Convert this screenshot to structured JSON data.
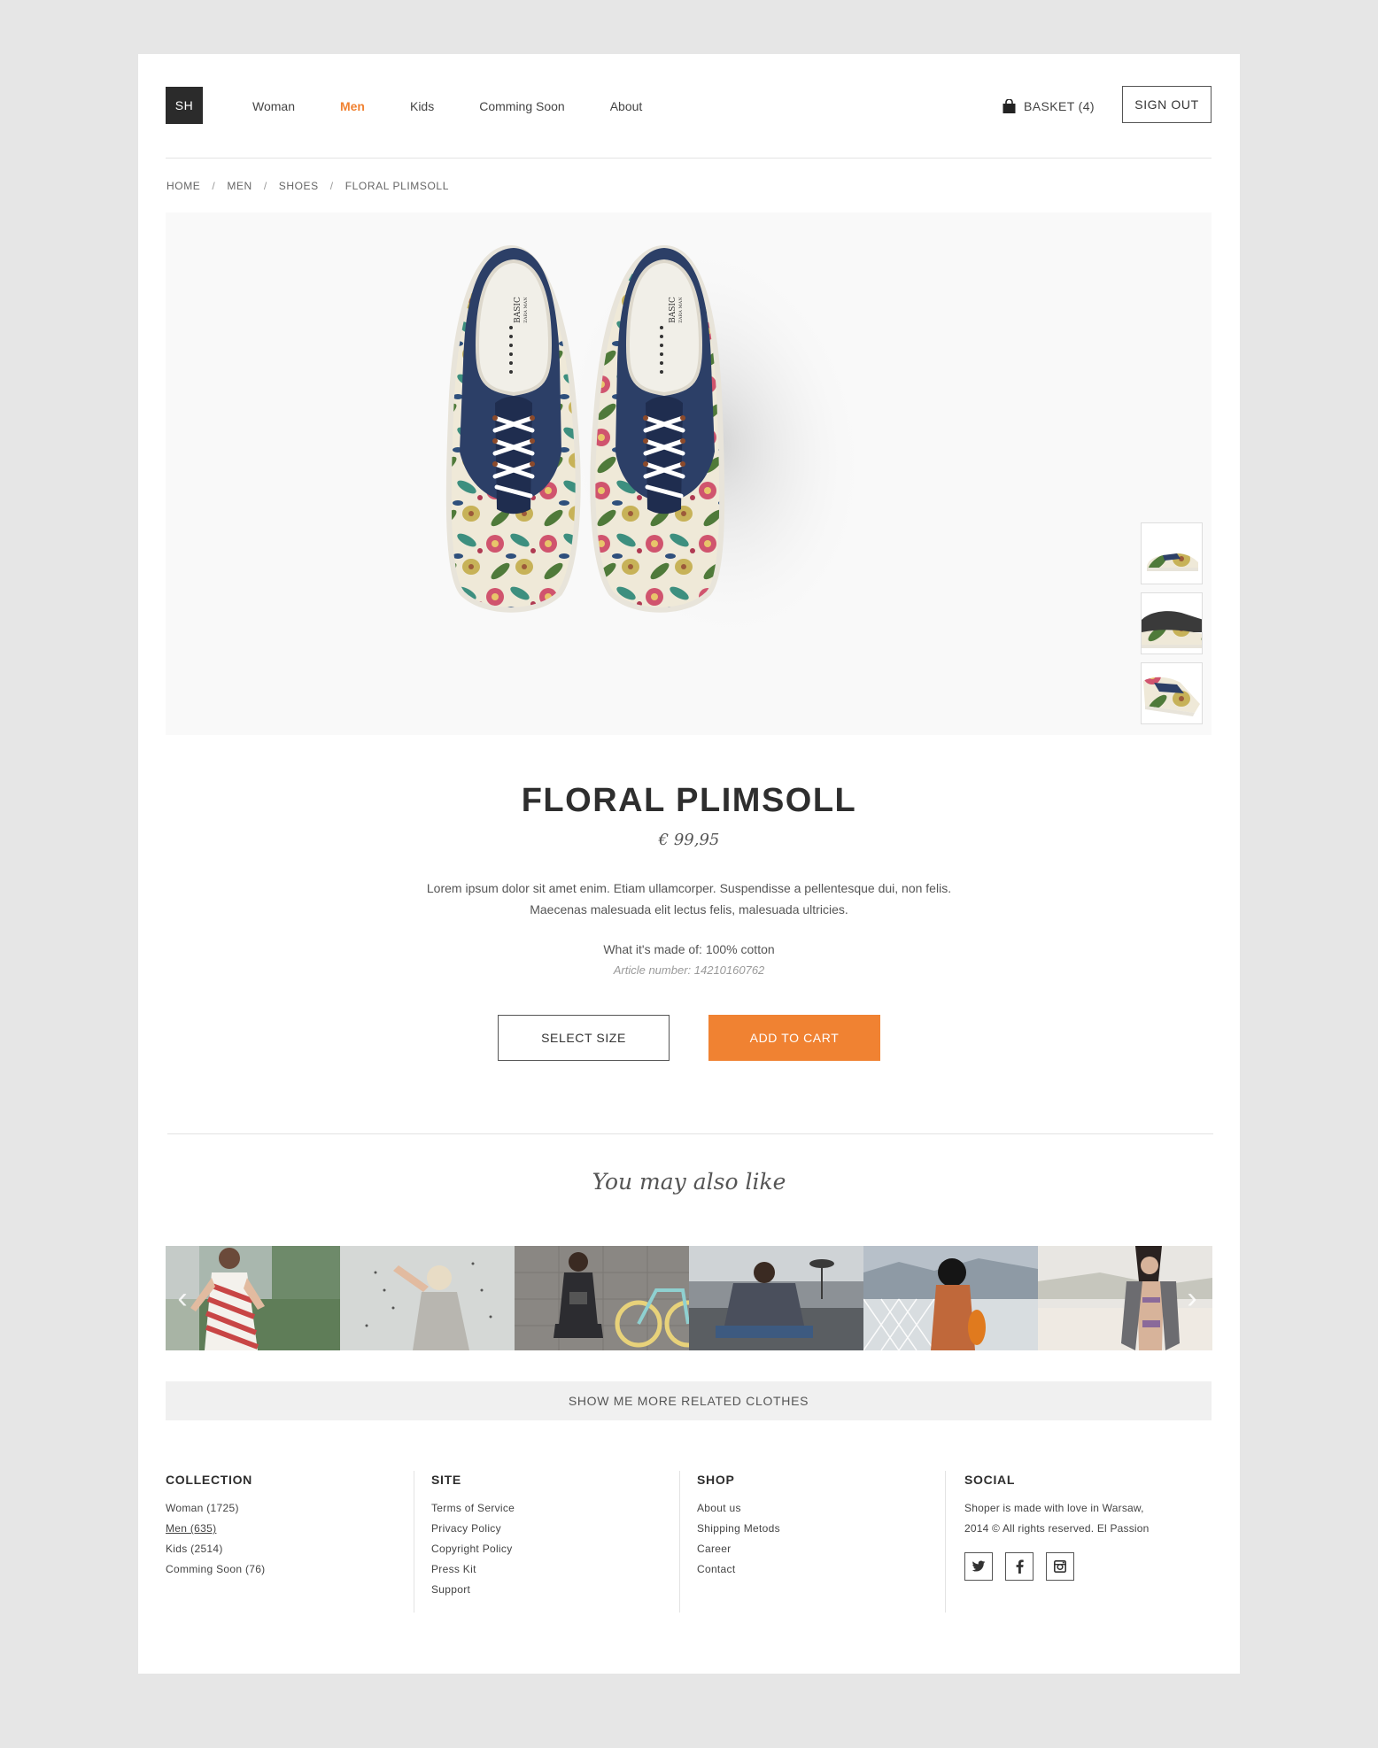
{
  "header": {
    "logo": "SH",
    "nav": [
      "Woman",
      "Men",
      "Kids",
      "Comming Soon",
      "About"
    ],
    "active_nav": "Men",
    "basket_label": "BASKET (4)",
    "sign_out": "SIGN OUT"
  },
  "breadcrumb": [
    "HOME",
    "MEN",
    "SHOES",
    "FLORAL PLIMSOLL"
  ],
  "product": {
    "title": "FLORAL PLIMSOLL",
    "price": "€ 99,95",
    "description_line1": "Lorem ipsum dolor sit amet enim. Etiam ullamcorper. Suspendisse a pellentesque dui, non felis.",
    "description_line2": "Maecenas malesuada elit lectus felis, malesuada ultricies.",
    "material": "What it's made of: 100% cotton",
    "article": "Article number: 14210160762",
    "insole_brand": "BASIC",
    "insole_subbrand": "ZARA MAN",
    "select_size": "SELECT SIZE",
    "add_to_cart": "ADD TO CART"
  },
  "related": {
    "heading": "You may also like",
    "show_more": "SHOW ME MORE RELATED CLOTHES"
  },
  "footer": {
    "collection": {
      "title": "COLLECTION",
      "items": [
        "Woman (1725)",
        "Men (635)",
        "Kids (2514)",
        "Comming Soon (76)"
      ]
    },
    "site": {
      "title": "SITE",
      "items": [
        "Terms of Service",
        "Privacy Policy",
        "Copyright Policy",
        "Press Kit",
        "Support"
      ]
    },
    "shop": {
      "title": "SHOP",
      "items": [
        "About us",
        "Shipping Metods",
        "Career",
        "Contact"
      ]
    },
    "social": {
      "title": "SOCIAL",
      "line1": "Shoper is made with love in Warsaw,",
      "line2": "2014 © All rights reserved. El Passion",
      "icons": [
        "twitter-icon",
        "facebook-icon",
        "instagram-icon"
      ]
    }
  },
  "colors": {
    "accent": "#f08232",
    "dark": "#2b2b2b",
    "background": "#e6e6e6"
  }
}
